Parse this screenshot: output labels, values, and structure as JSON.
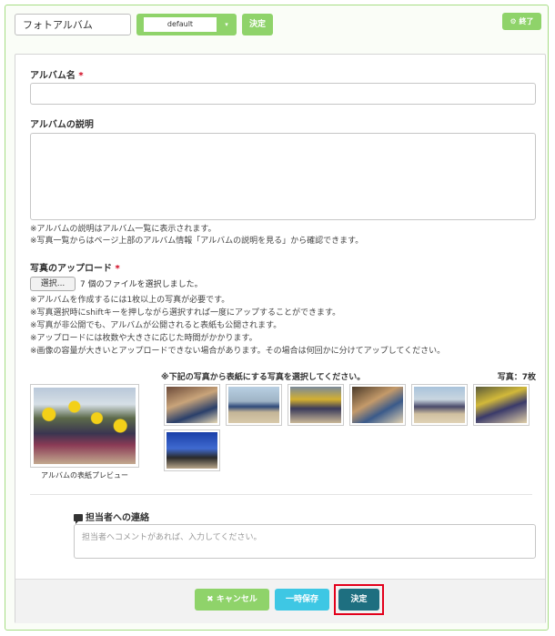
{
  "topbar": {
    "album_tab": "フォトアルバム",
    "select_value": "default",
    "select_arrow": "▾",
    "decide_label": "決定",
    "end_label": "⚙ 終了"
  },
  "form": {
    "album_name_label": "アルバム名",
    "required_mark": "*",
    "description_label": "アルバムの説明",
    "description_notes": [
      "※アルバムの説明はアルバム一覧に表示されます。",
      "※写真一覧からはページ上部のアルバム情報「アルバムの説明を見る」から確認できます。"
    ],
    "upload_label": "写真のアップロード",
    "file_button": "選択...",
    "file_status": "7 個のファイルを選択しました。",
    "upload_notes": [
      "※アルバムを作成するには1枚以上の写真が必要です。",
      "※写真選択時にshiftキーを押しながら選択すれば一度にアップすることができます。",
      "※写真が非公開でも、アルバムが公開されると表紙も公開されます。",
      "※アップロードには枚数や大きさに応じた時間がかかります。",
      "※画像の容量が大きいとアップロードできない場合があります。その場合は何回かに分けてアップしてください。"
    ],
    "preview_caption": "アルバムの表紙プレビュー",
    "thumbs_title": "※下記の写真から表紙にする写真を選択してください。",
    "thumbs_count": "写真：7枚",
    "contact_label": "担当者への連絡",
    "contact_placeholder": "担当者へコメントがあれば、入力してください。"
  },
  "footer": {
    "cancel_label": "✖ キャンセル",
    "draft_label": "一時保存",
    "decide_label": "決定"
  },
  "colors": {
    "accent_green": "#8fd36a",
    "draft_blue": "#3ec7e4",
    "decide_teal": "#1e6f80",
    "highlight_red": "#e3001b"
  }
}
